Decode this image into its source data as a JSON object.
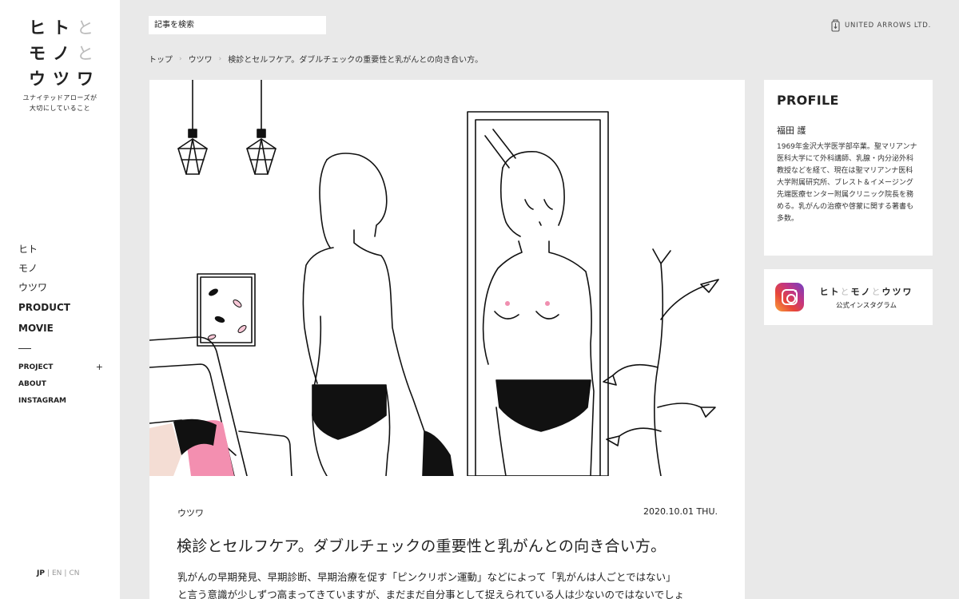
{
  "sidebar": {
    "logo": {
      "row1": [
        "ヒ",
        "ト",
        "と"
      ],
      "row2": [
        "モ",
        "ノ",
        "と"
      ],
      "row3": [
        "ウ",
        "ツ",
        "ワ"
      ],
      "tagline_line1": "ユナイテッドアローズが",
      "tagline_line2": "大切にしていること"
    },
    "nav_main": [
      "ヒト",
      "モノ",
      "ウツワ",
      "PRODUCT",
      "MOVIE"
    ],
    "nav_sub": [
      "PROJECT",
      "ABOUT",
      "INSTAGRAM"
    ],
    "project_toggle": "+",
    "languages": [
      "JP",
      "EN",
      "CN"
    ],
    "active_language": "JP"
  },
  "header": {
    "search_placeholder": "記事を検索",
    "brand": "UNITED ARROWS LTD."
  },
  "breadcrumb": [
    "トップ",
    "ウツワ",
    "検診とセルフケア。ダブルチェックの重要性と乳がんとの向き合い方。"
  ],
  "article": {
    "category": "ウツワ",
    "date": "2020.10.01 THU.",
    "title": "検診とセルフケア。ダブルチェックの重要性と乳がんとの向き合い方。",
    "body_line1": "乳がんの早期発見、早期診断、早期治療を促す「ピンクリボン運動」などによって「乳がんは人ごとではない」",
    "body_line2": "と言う意識が少しずつ高まってきていますが、まだまだ自分事として捉えられている人は少ないのではないでしょ",
    "accent_color": "#f08fb0"
  },
  "profile": {
    "heading": "PROFILE",
    "name": "福田 護",
    "bio": "1969年金沢大学医学部卒業。聖マリアンナ医科大学にて外科講師、乳腺・内分泌外科教授などを経て、現在は聖マリアンナ医科大学附属研究所、ブレスト＆イメージング先端医療センター附属クリニック院長を務める。乳がんの治療や啓蒙に関する著書も多数。"
  },
  "instagram": {
    "title_parts": [
      "ヒト",
      "と",
      "モノ",
      "と",
      "ウツワ"
    ],
    "subtitle": "公式インスタグラム"
  }
}
